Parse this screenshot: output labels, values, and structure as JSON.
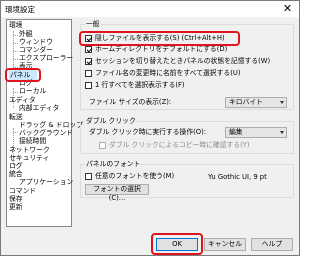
{
  "window": {
    "title": "環境設定",
    "close_glyph": "✕"
  },
  "tree": {
    "items": [
      "環境",
      "外観",
      "ウィンドウ",
      "コマンダー",
      "エクスプローラー",
      "表示",
      "パネル",
      "ログ",
      "ローカル",
      "エディタ",
      "内部エディタ",
      "転送",
      "ドラッグ & ドロップ",
      "バックグラウンド",
      "接続時間",
      "ネットワーク",
      "セキュリティ",
      "ログ",
      "統合",
      "アプリケーション",
      "コマンド",
      "保存",
      "更新"
    ]
  },
  "general": {
    "label": "一般",
    "checkboxes": [
      {
        "label": "隠しファイルを表示する(S) (Ctrl+Alt+H)",
        "checked": true
      },
      {
        "label": "ホームディレクトリをデフォルトにする(D)",
        "checked": true
      },
      {
        "label": "セッションを切り替えたときパネルの状態を記憶する(W)",
        "checked": true
      },
      {
        "label": "ファイル名の変更時に名前をすべて選択する(U)",
        "checked": false
      },
      {
        "label": "1 行すべてを選択表示する(F)",
        "checked": false
      }
    ],
    "filesize_label": "ファイル サイズの表示(Z):",
    "filesize_value": "キロバイト"
  },
  "doubleclick": {
    "label": "ダブル クリック",
    "action_label": "ダブル クリック時に実行する操作(O):",
    "action_value": "編集",
    "confirm_label": "ダブル クリックによるコピー時に確認する(Y)",
    "confirm_checked": false
  },
  "font": {
    "label": "パネルのフォント",
    "custom_label": "任意のフォントを使う(M)",
    "custom_checked": false,
    "select_button": "フォントの選択(C)...",
    "preview": "Yu Gothic UI, 9 pt"
  },
  "buttons": {
    "ok": "OK",
    "cancel": "キャンセル",
    "help": "ヘルプ"
  },
  "colors": {
    "highlight": "#e0141e",
    "selection": "#cce8ff"
  }
}
